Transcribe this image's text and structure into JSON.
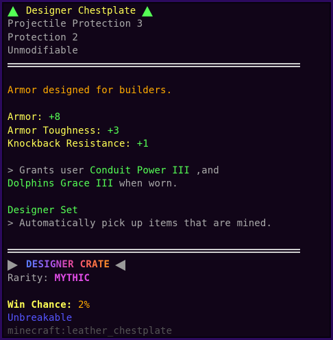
{
  "item": {
    "title": "Designer Chestplate",
    "enchantments": [
      "Projectile Protection 3",
      "Protection 2"
    ],
    "unmodifiable": "Unmodifiable",
    "description": "Armor designed for builders.",
    "stats": [
      {
        "label": "Armor:",
        "value": "+8"
      },
      {
        "label": "Armor Toughness:",
        "value": "+3"
      },
      {
        "label": "Knockback Resistance:",
        "value": "+1"
      }
    ],
    "grant_prefix": "> Grants user ",
    "grant_power1": "Conduit Power III",
    "grant_mid": " ,and",
    "grant_power2": "Dolphins Grace III",
    "grant_suffix": " when worn.",
    "set_name": "Designer Set",
    "set_bonus": "> Automatically pick up items that are mined.",
    "crate": "DESIGNER CRATE",
    "rarity_label": "Rarity:",
    "rarity_value": "MYTHIC",
    "win_label": "Win Chance:",
    "win_value": "2%",
    "unbreakable": "Unbreakable",
    "item_id": "minecraft:leather_chestplate"
  },
  "colors": {
    "title": "#ffff55",
    "stat_label": "#ffff55",
    "stat_value": "#55ff55",
    "description": "#ffaa00",
    "unbreakable": "#5555ff",
    "item_id": "#555555",
    "rarity_value": "#e24de8",
    "win_value": "#ffaa00",
    "background": "#110518",
    "border": "#2c0a5e"
  },
  "icons": [
    "green-triangle-up-icon",
    "gray-triangle-right-icon",
    "gray-triangle-left-icon"
  ]
}
